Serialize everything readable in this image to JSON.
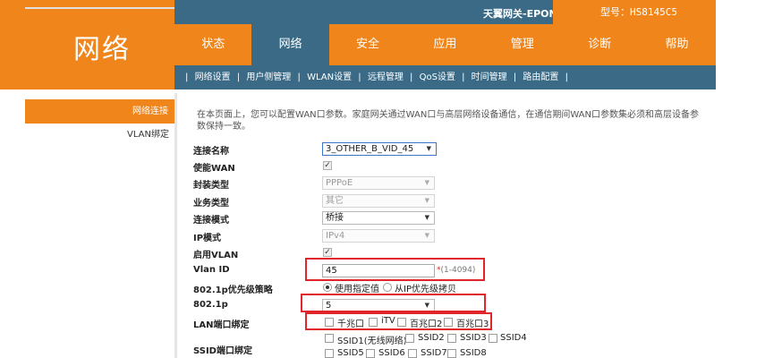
{
  "header": {
    "logo": "网络",
    "device_name": "天翼网关-EPON",
    "device_model": "型号：HS8145C5"
  },
  "nav": {
    "tabs": [
      {
        "label": "状态",
        "active": false
      },
      {
        "label": "网络",
        "active": true
      },
      {
        "label": "安全",
        "active": false
      },
      {
        "label": "应用",
        "active": false
      },
      {
        "label": "管理",
        "active": false
      },
      {
        "label": "诊断",
        "active": false
      },
      {
        "label": "帮助",
        "active": false
      }
    ]
  },
  "subnav": {
    "leading_sep": "|",
    "items": [
      "网络设置",
      "用户侧管理",
      "WLAN设置",
      "远程管理",
      "QoS设置",
      "时间管理",
      "路由配置"
    ],
    "sep": "|"
  },
  "sidebar": {
    "active_item": "网络连接",
    "items": [
      "VLAN绑定"
    ]
  },
  "content": {
    "description": "在本页面上，您可以配置WAN口参数。家庭网关通过WAN口与高层网络设备通信，在通信期间WAN口参数集必须和高层设备参数保持一致。",
    "fields": {
      "connection_name": {
        "label": "连接名称",
        "value": "3_OTHER_B_VID_45"
      },
      "enable_wan": {
        "label": "使能WAN",
        "checked": true
      },
      "encapsulation": {
        "label": "封装类型",
        "value": "PPPoE"
      },
      "service_type": {
        "label": "业务类型",
        "value": "其它"
      },
      "connection_mode": {
        "label": "连接模式",
        "value": "桥接"
      },
      "ip_mode": {
        "label": "IP模式",
        "value": "IPv4"
      },
      "enable_vlan": {
        "label": "启用VLAN",
        "checked": true
      },
      "vlan_id": {
        "label": "Vlan ID",
        "value": "45",
        "hint_star": "*",
        "hint": "(1-4094)"
      },
      "priority_policy": {
        "label": "802.1p优先级策略",
        "option1": "使用指定值",
        "option2": "从IP优先级拷贝"
      },
      "dot1p": {
        "label": "802.1p",
        "value": "5"
      },
      "lan_binding": {
        "label": "LAN端口绑定",
        "ports": [
          "千兆口",
          "iTV",
          "百兆口2",
          "百兆口3"
        ]
      },
      "ssid_binding": {
        "label": "SSID端口绑定",
        "row1": [
          "SSID1(无线网络)",
          "SSID2",
          "SSID3",
          "SSID4"
        ],
        "row2": [
          "SSID5",
          "SSID6",
          "SSID7",
          "SSID8"
        ]
      }
    }
  },
  "colors": {
    "orange": "#f0861b",
    "blue": "#3a6a86",
    "highlight_red": "#e0262b"
  }
}
